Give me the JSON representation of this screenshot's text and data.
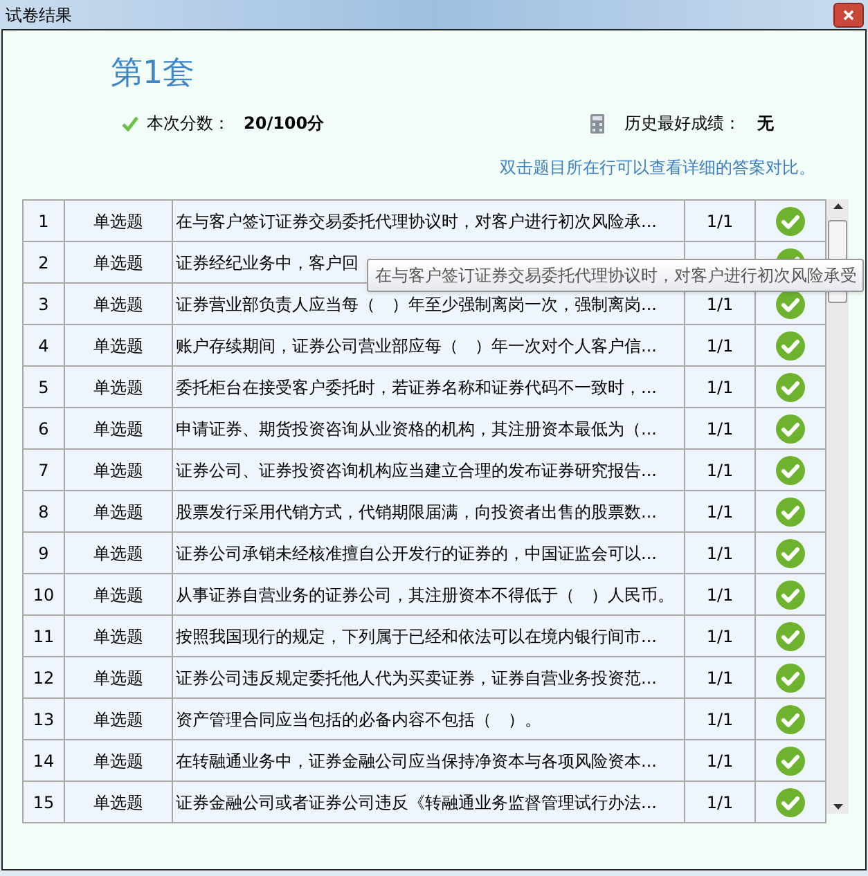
{
  "window": {
    "title": "试卷结果"
  },
  "paper_title": "第1套",
  "score": {
    "label": "本次分数：",
    "value": "20/100分"
  },
  "best": {
    "label": "历史最好成绩：",
    "value": "无"
  },
  "hint": "双击题目所在行可以查看详细的答案对比。",
  "rows": [
    {
      "no": "1",
      "type": "单选题",
      "question": "在与客户签订证券交易委托代理协议时，对客户进行初次风险承...",
      "score": "1/1",
      "correct": true
    },
    {
      "no": "2",
      "type": "单选题",
      "question": "证券经纪业务中，客户回",
      "correct": true
    },
    {
      "no": "3",
      "type": "单选题",
      "question": "证券营业部负责人应当每（　）年至少强制离岗一次，强制离岗...",
      "score": "1/1",
      "correct": true
    },
    {
      "no": "4",
      "type": "单选题",
      "question": "账户存续期间，证券公司营业部应每（　）年一次对个人客户信...",
      "score": "1/1",
      "correct": true
    },
    {
      "no": "5",
      "type": "单选题",
      "question": "委托柜台在接受客户委托时，若证券名称和证券代码不一致时，...",
      "score": "1/1",
      "correct": true
    },
    {
      "no": "6",
      "type": "单选题",
      "question": "申请证券、期货投资咨询从业资格的机构，其注册资本最低为（...",
      "score": "1/1",
      "correct": true
    },
    {
      "no": "7",
      "type": "单选题",
      "question": "证券公司、证券投资咨询机构应当建立合理的发布证券研究报告...",
      "score": "1/1",
      "correct": true
    },
    {
      "no": "8",
      "type": "单选题",
      "question": "股票发行采用代销方式，代销期限届满，向投资者出售的股票数...",
      "score": "1/1",
      "correct": true
    },
    {
      "no": "9",
      "type": "单选题",
      "question": "证券公司承销未经核准擅自公开发行的证券的，中国证监会可以...",
      "score": "1/1",
      "correct": true
    },
    {
      "no": "10",
      "type": "单选题",
      "question": "从事证券自营业务的证券公司，其注册资本不得低于（　）人民币。",
      "score": "1/1",
      "correct": true
    },
    {
      "no": "11",
      "type": "单选题",
      "question": "按照我国现行的规定，下列属于已经和依法可以在境内银行间市...",
      "score": "1/1",
      "correct": true
    },
    {
      "no": "12",
      "type": "单选题",
      "question": "证券公司违反规定委托他人代为买卖证券，证券自营业务投资范...",
      "score": "1/1",
      "correct": true
    },
    {
      "no": "13",
      "type": "单选题",
      "question": "资产管理合同应当包括的必备内容不包括（　）。",
      "score": "1/1",
      "correct": true
    },
    {
      "no": "14",
      "type": "单选题",
      "question": "在转融通业务中，证券金融公司应当保持净资本与各项风险资本...",
      "score": "1/1",
      "correct": true
    },
    {
      "no": "15",
      "type": "单选题",
      "question": "证券金融公司或者证券公司违反《转融通业务监督管理试行办法...",
      "score": "1/1",
      "correct": true
    }
  ],
  "tooltip": "在与客户签订证券交易委托代理协议时，对客户进行初次风险承受"
}
